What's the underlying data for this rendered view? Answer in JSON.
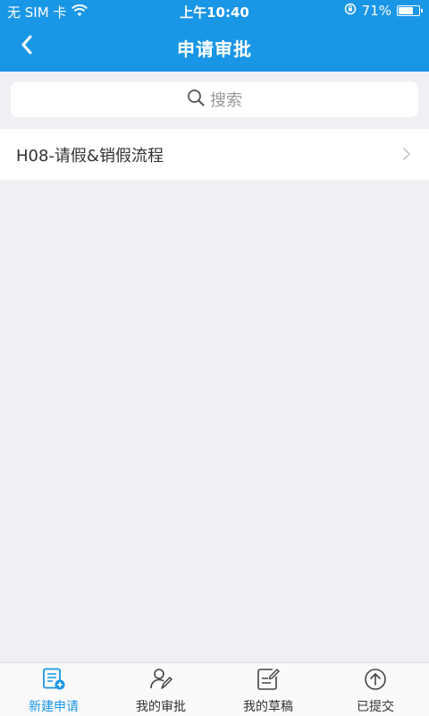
{
  "status_bar": {
    "carrier": "无 SIM 卡",
    "time": "上午10:40",
    "battery_percent": "71%",
    "battery_level": 0.71
  },
  "nav": {
    "title": "申请审批",
    "back_icon": "chevron-left-icon"
  },
  "search": {
    "placeholder": "搜索",
    "icon": "search-icon"
  },
  "list": {
    "items": [
      {
        "label": "H08-请假&销假流程"
      }
    ]
  },
  "tabs": [
    {
      "label": "新建申请",
      "icon": "new-request-icon",
      "active": true
    },
    {
      "label": "我的审批",
      "icon": "user-edit-icon",
      "active": false
    },
    {
      "label": "我的草稿",
      "icon": "draft-icon",
      "active": false
    },
    {
      "label": "已提交",
      "icon": "upload-circle-icon",
      "active": false
    }
  ],
  "colors": {
    "primary": "#1a96e6",
    "background": "#efeff4"
  }
}
